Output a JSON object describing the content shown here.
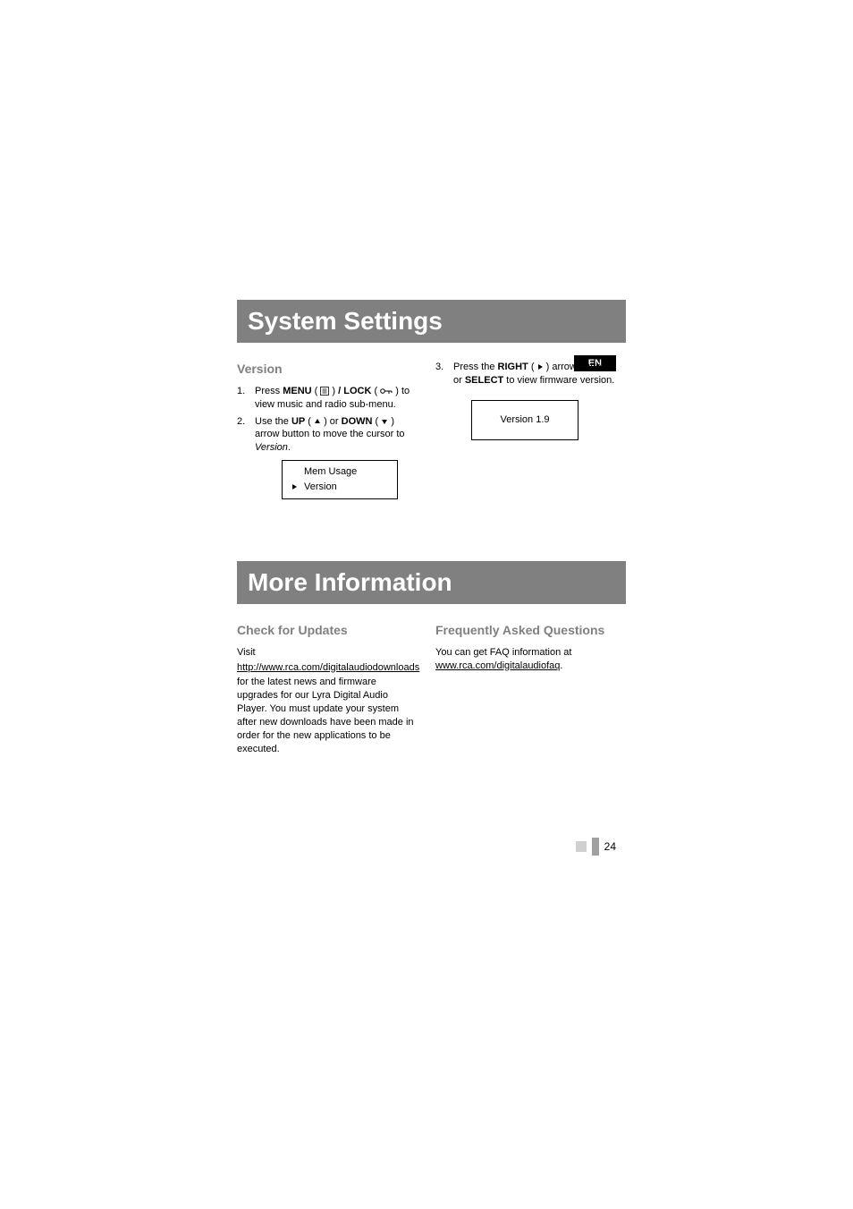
{
  "lang_badge": "EN",
  "page_number": "24",
  "sections": {
    "system_settings": {
      "title": "System Settings",
      "version_subheading": "Version",
      "steps": {
        "s1_a": "Press ",
        "s1_menu": "MENU",
        "s1_b": " ( ",
        "s1_c": " ) ",
        "s1_lock_label": "/ LOCK",
        "s1_d": " ( ",
        "s1_e": " ) to view music and radio sub-menu.",
        "s2_a": "Use the ",
        "s2_up": "UP",
        "s2_b": " ( ",
        "s2_c": " ) or ",
        "s2_down": "DOWN",
        "s2_d": " ( ",
        "s2_e": " ) arrow button to move the cursor to ",
        "s2_version": "Version",
        "s2_f": ".",
        "s3_a": "Press the ",
        "s3_right": "RIGHT",
        "s3_b": " ( ",
        "s3_c": " ) arrow button or ",
        "s3_select": "SELECT",
        "s3_d": " to view firmware version."
      },
      "lcd": {
        "row1": "Mem Usage",
        "row2": "Version"
      },
      "version_display": "Version 1.9"
    },
    "more_info": {
      "title": "More Information",
      "updates_subheading": "Check for Updates",
      "updates_intro": "Visit",
      "updates_link": "http://www.rca.com/digitalaudiodownloads",
      "updates_body": "for the latest news and firmware upgrades for our Lyra Digital Audio Player. You must update your system after new downloads have been made in order for the new applications to be executed.",
      "faq_subheading": "Frequently Asked Questions",
      "faq_intro": "You can get FAQ information at ",
      "faq_link": "www.rca.com/digitalaudiofaq",
      "faq_after": "."
    }
  }
}
